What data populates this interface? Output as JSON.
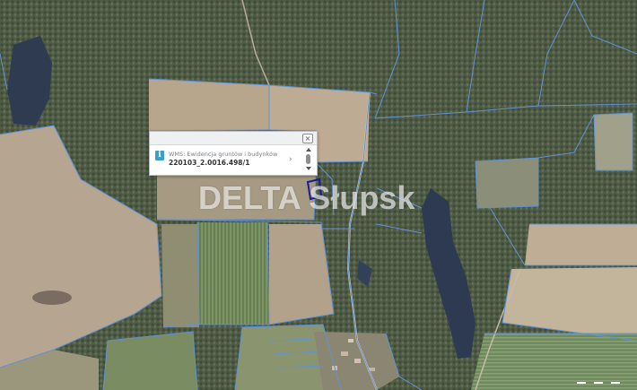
{
  "popup": {
    "close_glyph": "×",
    "info_glyph": "i",
    "layer_label": "WMS: Ewidencja gruntów i budynków",
    "parcel_id": "220103_2.0016.498/1",
    "next_glyph": "›"
  },
  "watermark": {
    "text": "DELTA Słupsk"
  },
  "colors": {
    "forest": "#4e5a45",
    "field": "#b8a48c",
    "parcel_border": "#5f92d6",
    "selected_parcel": "#1a1a9a",
    "lake": "#2f3c52"
  }
}
